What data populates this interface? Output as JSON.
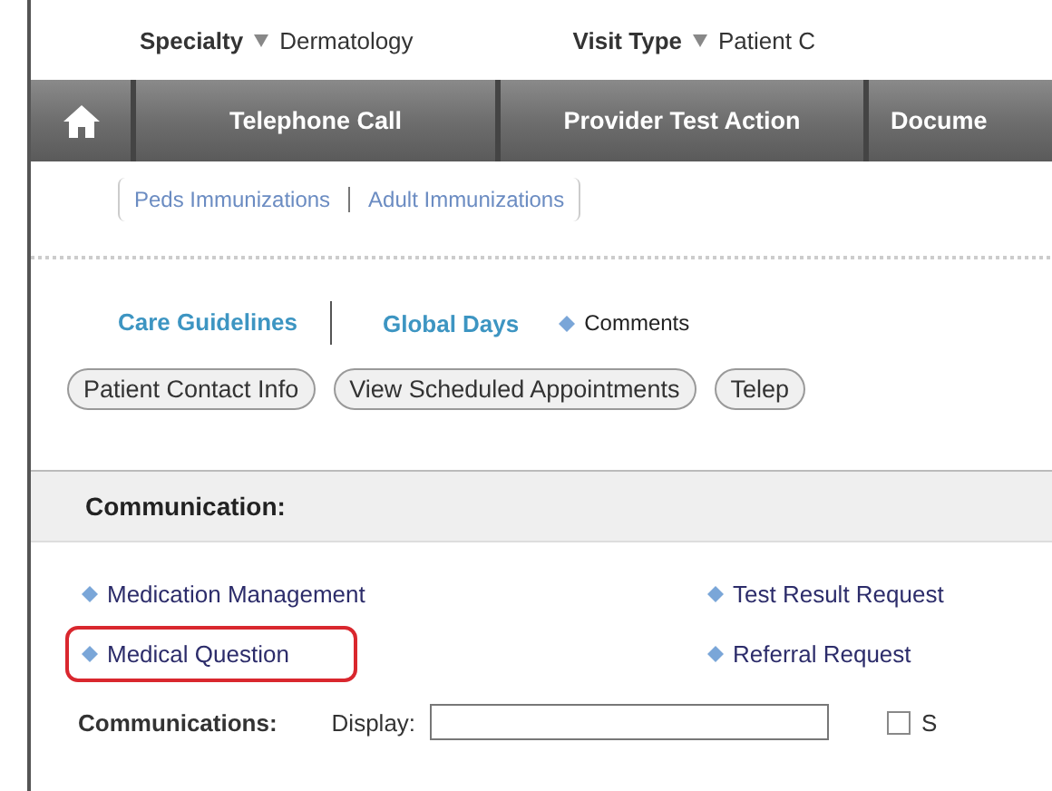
{
  "header": [
    {
      "label": "Specialty",
      "value": "Dermatology"
    },
    {
      "label": "Visit Type",
      "value": "Patient C"
    }
  ],
  "nav": {
    "tabs": [
      {
        "label": "Telephone Call",
        "selected": false
      },
      {
        "label": "Provider Test Action",
        "selected": false
      },
      {
        "label": "Docume",
        "selected": false
      }
    ]
  },
  "immunization_links": [
    "Peds Immunizations",
    "Adult Immunizations"
  ],
  "links": [
    {
      "label": "Care Guidelines",
      "kind": "tab"
    },
    {
      "label": "Global Days",
      "kind": "tab"
    },
    {
      "label": "Comments",
      "kind": "bullet"
    }
  ],
  "buttons": [
    "Patient Contact Info",
    "View Scheduled Appointments",
    "Telep"
  ],
  "section": {
    "title": "Communication:",
    "items": [
      {
        "label": "Medication Management",
        "highlighted": false
      },
      {
        "label": "Test Result Request",
        "highlighted": false
      },
      {
        "label": "Medical Question",
        "highlighted": true
      },
      {
        "label": "Referral Request",
        "highlighted": false
      }
    ]
  },
  "communications": {
    "label": "Communications:",
    "display_label": "Display:",
    "checkbox": {
      "label": "S",
      "checked": false
    }
  }
}
